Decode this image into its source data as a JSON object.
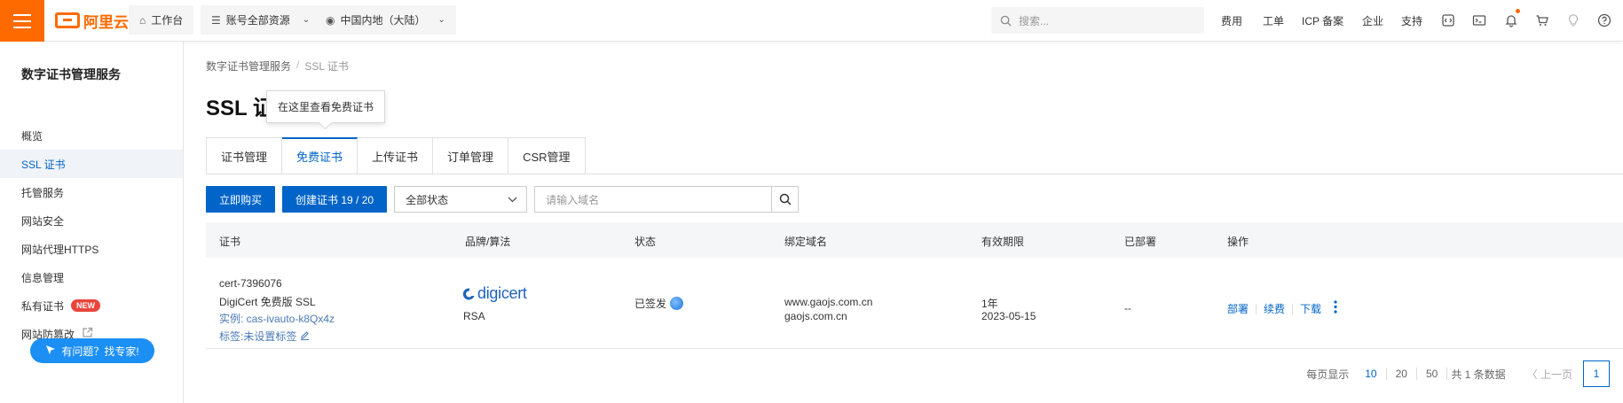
{
  "topbar": {
    "logo_text": "阿里云",
    "workbench": "工作台",
    "account_scope": "账号全部资源",
    "region": "中国内地（大陆）",
    "search_placeholder": "搜索...",
    "links": [
      "费用",
      "工单",
      "ICP 备案",
      "企业",
      "支持"
    ],
    "icons": [
      "code-icon",
      "terminal-icon",
      "bell-icon",
      "cart-icon",
      "bulb-icon",
      "help-icon"
    ]
  },
  "sidebar": {
    "title": "数字证书管理服务",
    "items": [
      {
        "label": "概览"
      },
      {
        "label": "SSL 证书"
      },
      {
        "label": "托管服务"
      },
      {
        "label": "网站安全"
      },
      {
        "label": "网站代理HTTPS"
      },
      {
        "label": "信息管理"
      },
      {
        "label": "私有证书",
        "badge": "NEW"
      },
      {
        "label": "网站防篡改"
      }
    ],
    "help_button": "有问题？找专家!"
  },
  "breadcrumb": {
    "root": "数字证书管理服务",
    "separator": "/",
    "current": "SSL 证书"
  },
  "page": {
    "title": "SSL 证",
    "tooltip": "在这里查看免费证书"
  },
  "tabs": [
    "证书管理",
    "免费证书",
    "上传证书",
    "订单管理",
    "CSR管理"
  ],
  "toolbar": {
    "buy_button": "立即购买",
    "create_button": "创建证书 19 / 20",
    "status_select": "全部状态",
    "domain_placeholder": "请输入域名"
  },
  "table": {
    "headers": [
      "证书",
      "品牌/算法",
      "状态",
      "绑定域名",
      "有效期限",
      "已部署",
      "操作"
    ],
    "rows": [
      {
        "cert_id": "cert-7396076",
        "cert_name": "DigiCert 免费版 SSL",
        "instance": "实例: cas-ivauto-k8Qx4z",
        "tags": "标签:未设置标签",
        "brand": "digicert",
        "algorithm": "RSA",
        "status": "已签发",
        "domains": [
          "www.gaojs.com.cn",
          "gaojs.com.cn"
        ],
        "validity": "1年",
        "expire_date": "2023-05-15",
        "deployed": "--",
        "actions": [
          "部署",
          "续费",
          "下载"
        ]
      }
    ]
  },
  "pagination": {
    "page_size_label": "每页显示",
    "page_sizes": [
      "10",
      "20",
      "50"
    ],
    "total": "共 1 条数据",
    "prev": "〈 上一页",
    "current_page": "1"
  },
  "colors": {
    "brand_orange": "#ff6a00",
    "primary_blue": "#0064c8",
    "help_blue": "#1c8ff5",
    "new_badge": "#e8453c"
  }
}
